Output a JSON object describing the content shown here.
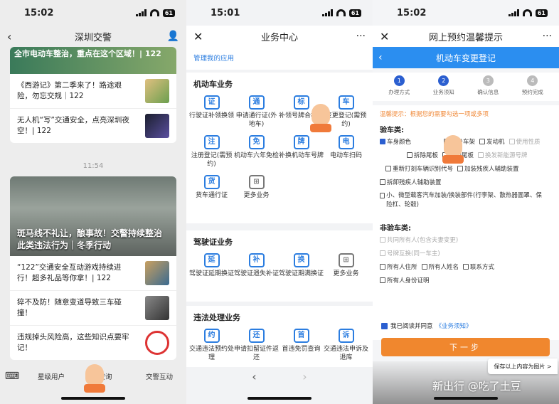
{
  "panel1": {
    "time": "15:02",
    "battery": "61",
    "title": "深圳交警",
    "banner_text": "全市电动车整治，重点在这个区域！| 122",
    "news_top": [
      {
        "text": "《西游记》第二季来了！路途艰险，勿忘交规｜122"
      },
      {
        "text": "无人机“写”交通安全，点亮深圳夜空！| 122"
      }
    ],
    "timestamp": "11:54",
    "photo_caption": "斑马线不礼让，酿事故！交警持续整治此类违法行为｜冬季行动",
    "news_bottom": [
      {
        "text": "“122”交通安全互动游戏持续进行！超多礼品等你拿！| 122"
      },
      {
        "text": "猝不及防！随意变道导致三车碰撞！"
      },
      {
        "text": "违规掉头风险高，这些知识点要牢记！"
      }
    ],
    "tabs": [
      "星级用户",
      "查询",
      "交警互动"
    ]
  },
  "panel2": {
    "time": "15:01",
    "battery": "61",
    "title": "业务中心",
    "manage_link": "管理我的应用",
    "sections": [
      {
        "title": "机动车业务",
        "items": [
          "行驶证补领换领",
          "申请通行证(外地车)",
          "补领号牌合标志",
          "变更登记(需预约)",
          "注册登记(需预约)",
          "机动车六年免检",
          "补换机动车号牌",
          "电动车扫码",
          "货车通行证",
          "更多业务"
        ]
      },
      {
        "title": "驾驶证业务",
        "items": [
          "驾驶证延期换证",
          "驾驶证遗失补证",
          "驾驶证期满换证",
          "更多业务"
        ]
      },
      {
        "title": "违法处理业务",
        "items": [
          "交通违法预约处理",
          "申请扣留证件返还",
          "首违免罚查询",
          "交通违法申诉及退库"
        ]
      }
    ]
  },
  "panel3": {
    "time": "15:02",
    "battery": "61",
    "title": "网上预约温馨提示",
    "header": "机动车变更登记",
    "steps": [
      {
        "num": "1",
        "label": "办理方式",
        "state": "on"
      },
      {
        "num": "2",
        "label": "业务须知",
        "state": "on"
      },
      {
        "num": "3",
        "label": "确认信息",
        "state": "off"
      },
      {
        "num": "4",
        "label": "预约完成",
        "state": "off"
      }
    ],
    "tip": "温馨提示：根据您的需要勾选一项或多项",
    "group1_title": "验车类:",
    "group1_options": [
      {
        "label": "车身颜色",
        "checked": true,
        "disabled": false
      },
      {
        "label": "车身车架",
        "checked": false,
        "disabled": false
      },
      {
        "label": "发动机",
        "checked": false,
        "disabled": false
      },
      {
        "label": "使用性质",
        "checked": false,
        "disabled": true
      },
      {
        "label": "拆除尾板",
        "checked": false,
        "disabled": false
      },
      {
        "label": "增加尾板",
        "checked": false,
        "disabled": false
      },
      {
        "label": "换发新能源号牌",
        "checked": false,
        "disabled": true
      },
      {
        "label": "重新打刻车辆识别代号",
        "checked": false,
        "disabled": false
      },
      {
        "label": "加装残疾人辅助装置",
        "checked": false,
        "disabled": false
      },
      {
        "label": "拆卸残疾人辅助装置",
        "checked": false,
        "disabled": false
      },
      {
        "label": "小、微型载客汽车加装/换装部件(行李架、散热器面罩、保险杠、轮毂)",
        "checked": false,
        "disabled": false
      }
    ],
    "group2_title": "非验车类:",
    "group2_options": [
      {
        "label": "共同所有人(包含夫妻变更)",
        "checked": false,
        "disabled": true
      },
      {
        "label": "号牌互换(同一车主)",
        "checked": false,
        "disabled": true
      },
      {
        "label": "所有人住所",
        "checked": false,
        "disabled": false
      },
      {
        "label": "所有人姓名",
        "checked": false,
        "disabled": false
      },
      {
        "label": "联系方式",
        "checked": false,
        "disabled": false
      },
      {
        "label": "所有人身份证明",
        "checked": false,
        "disabled": false
      }
    ],
    "agree_text": "我已阅读并同意",
    "agree_link": "《业务须知》",
    "next_button": "下一步",
    "toast": "保存以上内容为图片 >",
    "watermark": "新出行 @吃了土豆"
  }
}
